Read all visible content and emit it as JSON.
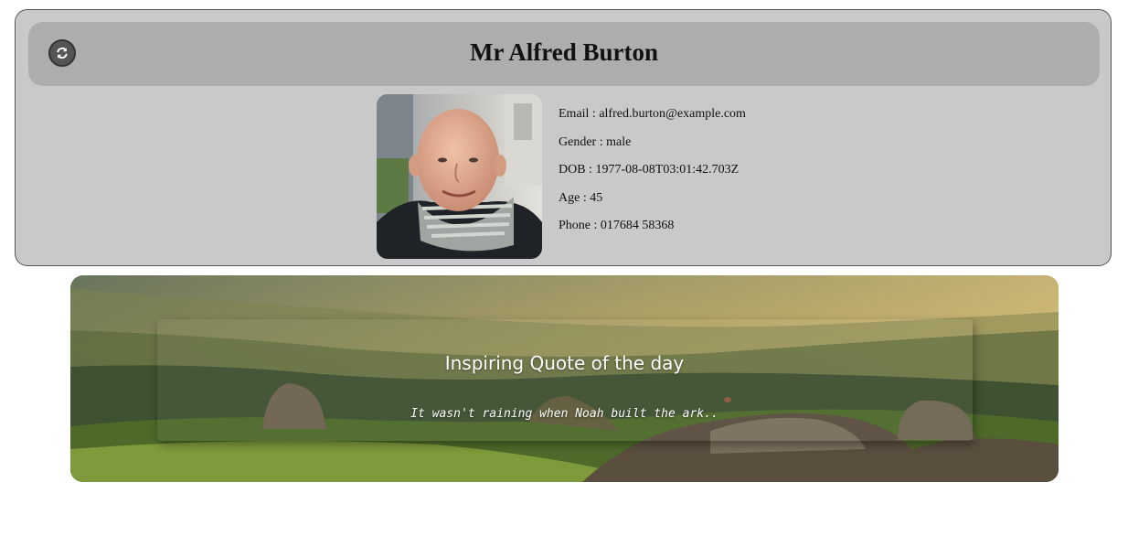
{
  "profile": {
    "name": "Mr Alfred Burton",
    "refresh_icon": "refresh-icon",
    "details": [
      {
        "key": "email",
        "text": "Email : alfred.burton@example.com"
      },
      {
        "key": "gender",
        "text": "Gender : male"
      },
      {
        "key": "dob",
        "text": "DOB : 1977-08-08T03:01:42.703Z"
      },
      {
        "key": "age",
        "text": "Age : 45"
      },
      {
        "key": "phone",
        "text": "Phone : 017684 58368"
      }
    ]
  },
  "quote": {
    "heading": "Inspiring Quote of the day",
    "text": "It wasn't raining when Noah built the ark.."
  },
  "colors": {
    "card_bg": "#c9c9c9",
    "header_bg": "#adadad"
  }
}
